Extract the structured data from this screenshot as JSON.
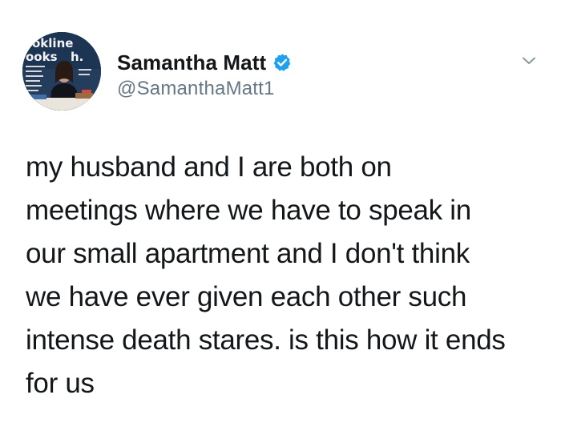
{
  "author": {
    "display_name": "Samantha Matt",
    "handle": "@SamanthaMatt1",
    "verified": true,
    "avatar_icon": "profile-photo",
    "avatar_sign_text": "Bookline Books with..."
  },
  "tweet": {
    "text": "my husband and I are both on\nmeetings where we have to speak in\nour small apartment and I don't think\nwe have ever given each other such\nintense death stares. is this how it ends\nfor us"
  },
  "menu": {
    "icon": "chevron-down-icon"
  },
  "colors": {
    "verified_blue": "#1da1f2",
    "text": "#14171a",
    "secondary_text": "#657786",
    "chevron": "#8899a6"
  }
}
